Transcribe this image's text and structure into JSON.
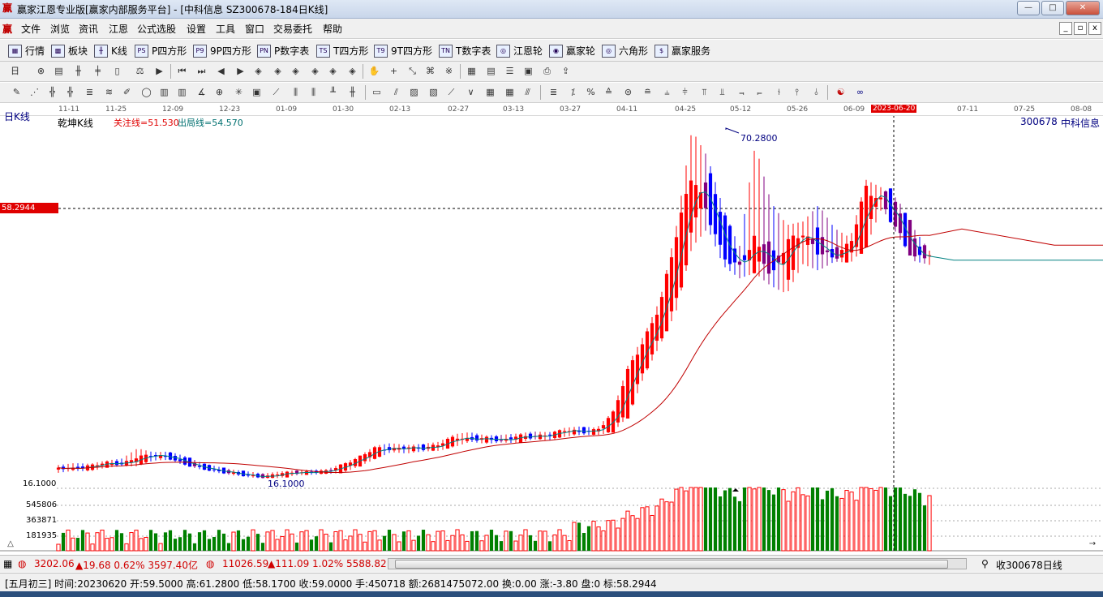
{
  "window": {
    "title": "赢家江恩专业版[赢家内部服务平台] - [中科信息  SZ300678-184日K线]",
    "app_icon": "赢",
    "buttons": {
      "minimize": "—",
      "maximize": "□",
      "close": "✕"
    }
  },
  "menu": {
    "logo": "赢",
    "items": [
      "文件",
      "浏览",
      "资讯",
      "江恩",
      "公式选股",
      "设置",
      "工具",
      "窗口",
      "交易委托",
      "帮助"
    ],
    "mdi_buttons": [
      "_",
      "▫",
      "x"
    ]
  },
  "funcbar": {
    "items": [
      {
        "label": "行情",
        "icon": "grid-icon"
      },
      {
        "label": "板块",
        "icon": "blocks-icon"
      },
      {
        "label": "K线",
        "icon": "candle-icon"
      },
      {
        "label": "P四方形",
        "icon": "ps-icon"
      },
      {
        "label": "9P四方形",
        "icon": "p9-icon"
      },
      {
        "label": "P数字表",
        "icon": "pn-icon"
      },
      {
        "label": "T四方形",
        "icon": "ts-icon"
      },
      {
        "label": "9T四方形",
        "icon": "t9-icon"
      },
      {
        "label": "T数字表",
        "icon": "tn-icon"
      },
      {
        "label": "江恩轮",
        "icon": "wheel-icon"
      },
      {
        "label": "赢家轮",
        "icon": "wheel2-icon"
      },
      {
        "label": "六角形",
        "icon": "hexagon-icon"
      },
      {
        "label": "赢家服务",
        "icon": "dollar-icon"
      }
    ],
    "icon_text": [
      "▦",
      "▩",
      "╫",
      "PS",
      "P9",
      "PN",
      "TS",
      "T9",
      "TN",
      "◎",
      "◉",
      "◎",
      "$"
    ]
  },
  "chart": {
    "kline_label": "日K线",
    "indicator_name": "乾坤K线",
    "attention_line": "关注线=51.530",
    "exit_line": "出局线=54.570",
    "stock_code": "300678",
    "stock_name": "中科信息",
    "cursor_price": "58.2944",
    "max_price_label": "70.2800",
    "min_price_label": "16.1000",
    "axis_low": "16.1000",
    "volume_labels": [
      "545806",
      "363871",
      "181935"
    ],
    "highlight_date": "2023-06-20",
    "x_dates": [
      "11-11",
      "11-25",
      "12-09",
      "12-23",
      "01-09",
      "01-30",
      "02-13",
      "02-27",
      "03-13",
      "03-27",
      "04-11",
      "04-25",
      "05-12",
      "05-26",
      "06-09",
      "07-11",
      "07-25",
      "08-08"
    ],
    "colors": {
      "up": "#ff0000",
      "down": "#0000ff",
      "flat": "#800080",
      "vol_up": "#ff0000",
      "vol_down": "#008000",
      "ma_short": "#008080",
      "ma_long": "#c00000"
    }
  },
  "chart_data": {
    "type": "candlestick",
    "ylim": [
      16.1,
      70.28
    ],
    "prices_daily_approx": [
      [
        17.5,
        18.2,
        17.0,
        17.8
      ],
      [
        17.8,
        18.5,
        17.3,
        17.6
      ],
      [
        17.6,
        18.4,
        17.2,
        18.1
      ],
      [
        18.1,
        18.9,
        17.8,
        18.6
      ],
      [
        18.6,
        19.2,
        18.0,
        18.3
      ],
      [
        18.3,
        20.8,
        18.0,
        19.5
      ],
      [
        19.5,
        20.2,
        18.9,
        19.8
      ],
      [
        19.8,
        20.3,
        19.0,
        19.3
      ],
      [
        19.3,
        19.6,
        18.1,
        18.3
      ],
      [
        18.3,
        18.6,
        17.5,
        17.7
      ],
      [
        17.7,
        18.0,
        17.0,
        17.2
      ],
      [
        17.2,
        17.5,
        16.6,
        16.9
      ],
      [
        16.9,
        17.2,
        16.3,
        16.5
      ],
      [
        16.5,
        16.9,
        16.1,
        16.3
      ],
      [
        16.3,
        17.2,
        16.2,
        17.0
      ],
      [
        17.0,
        17.4,
        16.6,
        17.0
      ],
      [
        17.0,
        17.5,
        16.7,
        17.1
      ],
      [
        17.1,
        17.6,
        16.8,
        17.3
      ],
      [
        17.3,
        18.5,
        17.0,
        18.3
      ],
      [
        18.3,
        19.6,
        18.0,
        19.4
      ],
      [
        19.4,
        21.2,
        19.1,
        20.9
      ],
      [
        20.9,
        21.6,
        20.2,
        20.6
      ],
      [
        20.6,
        21.3,
        20.0,
        21.0
      ],
      [
        21.0,
        21.5,
        20.3,
        20.7
      ],
      [
        20.7,
        21.8,
        20.4,
        21.4
      ],
      [
        21.4,
        23.0,
        21.0,
        22.6
      ],
      [
        22.6,
        23.3,
        21.8,
        22.1
      ],
      [
        22.1,
        22.8,
        21.5,
        22.4
      ],
      [
        22.4,
        22.9,
        21.7,
        21.9
      ],
      [
        21.9,
        23.1,
        21.6,
        22.8
      ],
      [
        22.8,
        23.4,
        22.2,
        22.5
      ],
      [
        22.5,
        23.3,
        22.0,
        23.0
      ],
      [
        23.0,
        24.0,
        22.6,
        23.7
      ],
      [
        23.7,
        24.2,
        22.9,
        23.3
      ],
      [
        23.3,
        24.0,
        22.8,
        23.6
      ],
      [
        23.6,
        26.5,
        23.3,
        26.1
      ],
      [
        26.1,
        34.0,
        25.8,
        33.2
      ],
      [
        33.2,
        38.5,
        32.1,
        37.6
      ],
      [
        37.6,
        44.0,
        36.9,
        43.1
      ],
      [
        43.1,
        55.0,
        42.0,
        53.8
      ],
      [
        53.8,
        70.28,
        52.0,
        63.5
      ],
      [
        63.5,
        66.0,
        55.0,
        57.2
      ],
      [
        57.2,
        58.0,
        49.1,
        50.5
      ],
      [
        50.5,
        52.0,
        47.2,
        48.9
      ],
      [
        48.9,
        68.0,
        48.0,
        53.6
      ],
      [
        53.6,
        59.0,
        46.0,
        47.0
      ],
      [
        47.0,
        55.5,
        44.8,
        52.9
      ],
      [
        52.9,
        56.0,
        49.4,
        54.2
      ],
      [
        54.2,
        58.6,
        48.4,
        51.2
      ],
      [
        51.2,
        55.0,
        49.8,
        50.4
      ],
      [
        50.4,
        53.5,
        49.6,
        52.6
      ],
      [
        52.6,
        62.5,
        52.1,
        61.28
      ],
      [
        61.28,
        61.28,
        58.17,
        59.0
      ],
      [
        59.0,
        59.5,
        53.8,
        54.4
      ],
      [
        54.4,
        55.0,
        49.9,
        50.2
      ],
      [
        50.2,
        51.5,
        49.3,
        51.0
      ]
    ],
    "note_price_units": "yuan"
  },
  "statusbar": {
    "sh_index": "3202.06",
    "sh_change": "▲19.68 0.62% 3597.40亿",
    "sz_index": "11026.59",
    "sz_change": "▲111.09 1.02% 5588.82",
    "right_label": "收300678日线"
  },
  "infobar": {
    "text": "[五月初三] 时间:20230620 开:59.5000 高:61.2800 低:58.1700 收:59.0000 手:450718 额:2681475072.00 换:0.00 涨:-3.80 盘:0 标:58.2944"
  }
}
